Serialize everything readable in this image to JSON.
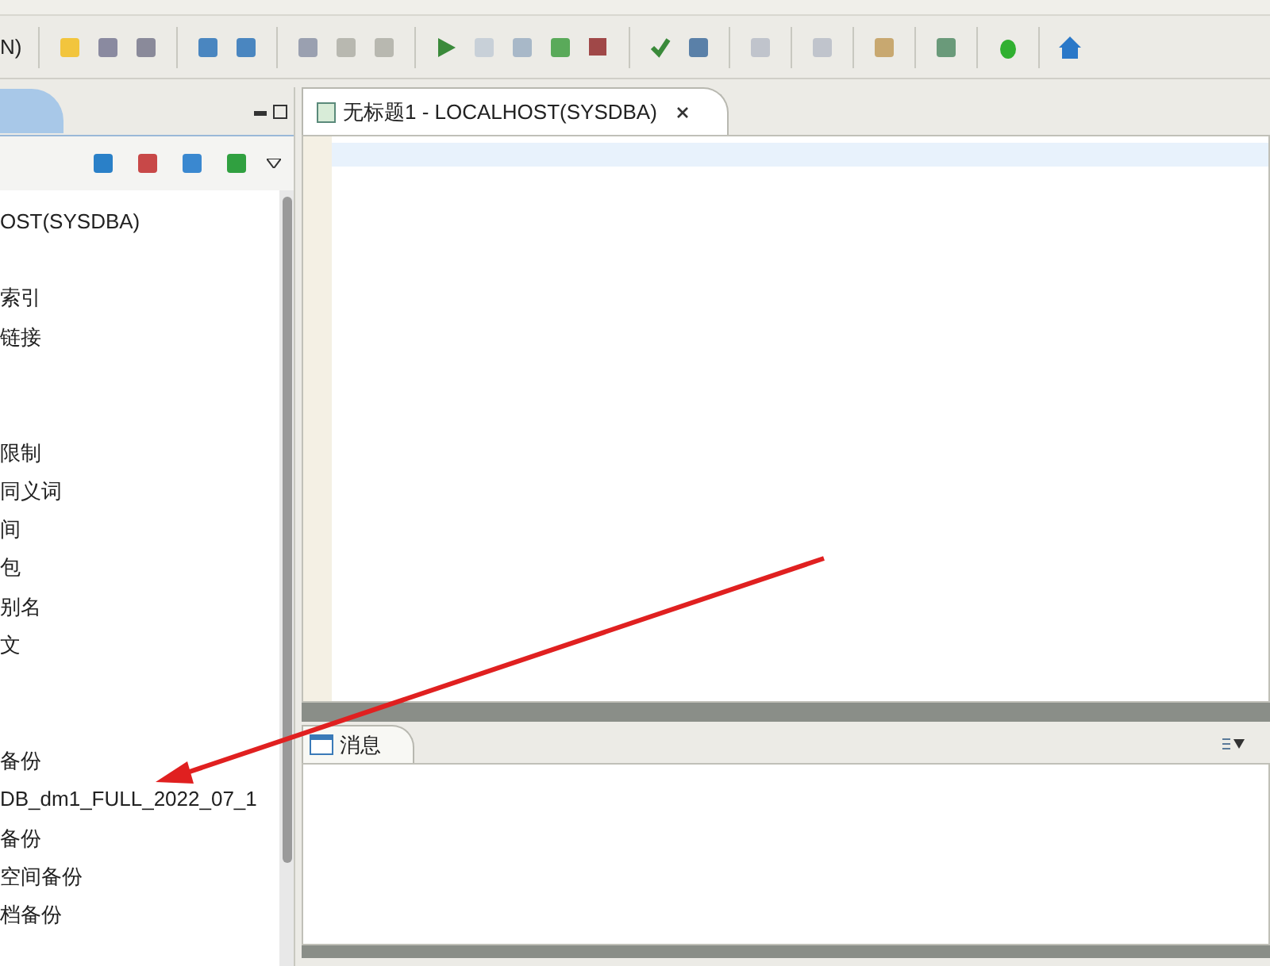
{
  "toolbar": {
    "combo_text": "N)"
  },
  "navigator": {
    "items": [
      {
        "kind": "node",
        "label": "OST(SYSDBA)"
      },
      {
        "kind": "blank"
      },
      {
        "kind": "node",
        "label": "索引"
      },
      {
        "kind": "node",
        "label": "链接"
      },
      {
        "kind": "blank"
      },
      {
        "kind": "blank"
      },
      {
        "kind": "node",
        "label": "限制"
      },
      {
        "kind": "node",
        "label": "同义词"
      },
      {
        "kind": "node",
        "label": "间"
      },
      {
        "kind": "node",
        "label": "包"
      },
      {
        "kind": "node",
        "label": "别名"
      },
      {
        "kind": "node",
        "label": "文"
      },
      {
        "kind": "blank"
      },
      {
        "kind": "blank"
      },
      {
        "kind": "node",
        "label": "备份"
      },
      {
        "kind": "node",
        "label": "DB_dm1_FULL_2022_07_1"
      },
      {
        "kind": "node",
        "label": "备份"
      },
      {
        "kind": "node",
        "label": "空间备份"
      },
      {
        "kind": "node",
        "label": "档备份"
      }
    ]
  },
  "editor": {
    "tab": {
      "title": "无标题1 - LOCALHOST(SYSDBA)",
      "selected": true
    }
  },
  "messages": {
    "tab": {
      "title": "消息",
      "selected": true
    }
  }
}
